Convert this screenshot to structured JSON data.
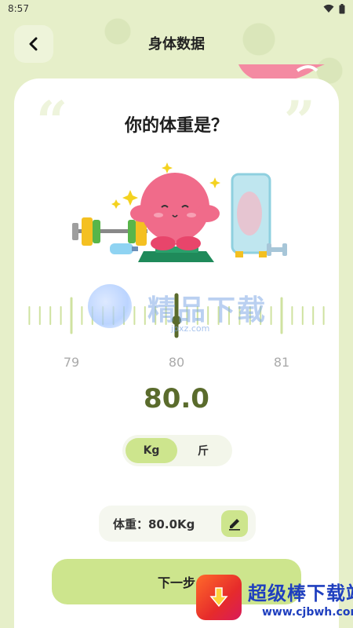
{
  "status_bar": {
    "time": "8:57"
  },
  "header": {
    "title": "身体数据"
  },
  "question": {
    "text": "你的体重是？"
  },
  "ruler": {
    "labels": [
      "79",
      "80",
      "81"
    ],
    "current": 80.0
  },
  "weight": {
    "display": "80.0"
  },
  "units": {
    "options": [
      "Kg",
      "斤"
    ],
    "selected": "Kg"
  },
  "summary": {
    "text": "体重：80.0Kg"
  },
  "next_button": {
    "label": "下一步"
  },
  "watermark": {
    "text": "精品下载",
    "url": "jpxz.com"
  },
  "site_badge": {
    "name": "超级棒下载站",
    "url": "www.cjbwh.com"
  },
  "colors": {
    "background": "#e6efc9",
    "accent": "#cde58d",
    "value_text": "#5a6b2c",
    "ruler_tick": "#cfe2a0",
    "ruler_indicator": "#5a6b2c",
    "mascot_pink": "#f06b8a"
  },
  "icons": {
    "back": "chevron-left-icon",
    "edit": "pencil-icon",
    "wifi": "wifi-icon",
    "battery": "battery-icon"
  }
}
